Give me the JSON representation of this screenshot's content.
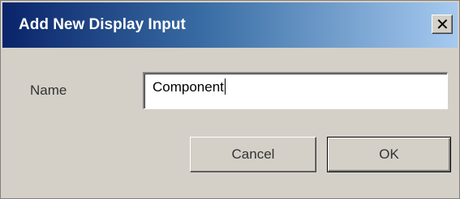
{
  "dialog": {
    "title": "Add New Display Input",
    "close_icon": "close-icon"
  },
  "form": {
    "name_label": "Name",
    "name_value": "Component"
  },
  "buttons": {
    "cancel_label": "Cancel",
    "ok_label": "OK"
  }
}
